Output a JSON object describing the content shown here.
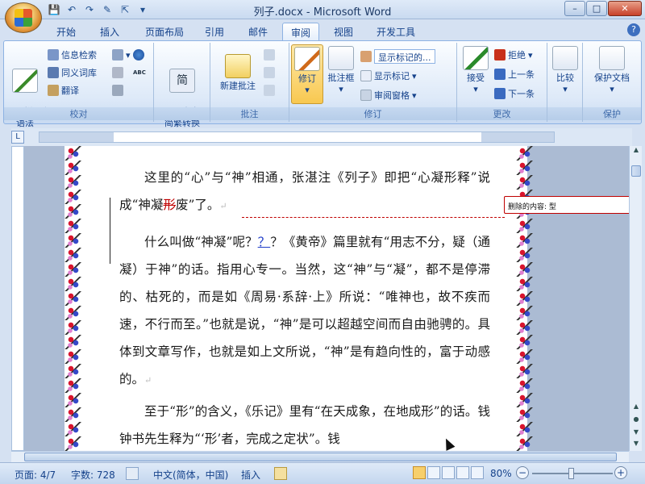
{
  "window": {
    "title": "列子.docx - Microsoft Word",
    "controls": [
      "–",
      "□",
      "✕"
    ]
  },
  "qat": [
    "💾",
    "↶",
    "↷",
    "✎",
    "⇱",
    "▾"
  ],
  "tabs": [
    {
      "label": "开始",
      "active": false
    },
    {
      "label": "插入",
      "active": false
    },
    {
      "label": "页面布局",
      "active": false
    },
    {
      "label": "引用",
      "active": false
    },
    {
      "label": "邮件",
      "active": false
    },
    {
      "label": "审阅",
      "active": true
    },
    {
      "label": "视图",
      "active": false
    },
    {
      "label": "开发工具",
      "active": false
    }
  ],
  "help": "?",
  "ribbon": {
    "proofing": {
      "label": "校对",
      "spelling": "拼写和\n语法",
      "research": "信息检索",
      "thesaurus": "同义词库",
      "translate": "翻译",
      "abc_icon": "ABC"
    },
    "chinese": {
      "label": "",
      "convert": "中文\n简繁转换",
      "icon_char": "简"
    },
    "comments": {
      "label": "批注",
      "new_comment": "新建批注"
    },
    "tracking": {
      "label": "修订",
      "track_changes": "修订",
      "balloons": "批注框",
      "display_combo": "显示标记的...",
      "show_markup": "显示标记",
      "reviewing_pane": "审阅窗格"
    },
    "changes": {
      "label": "更改",
      "accept": "接受",
      "reject": "拒绝",
      "previous": "上一条",
      "next": "下一条"
    },
    "compare": {
      "label": "",
      "compare": "比较"
    },
    "protect": {
      "label": "保护",
      "protect_doc": "保护文档"
    }
  },
  "document": {
    "p1": {
      "before": "这里的“心”与“神”相通，张湛注《列子》即把“心凝形释”说成“神凝",
      "deleted": "形",
      "after": "废”了。",
      "mark": "↵"
    },
    "p2": {
      "before": "什么叫做“神凝”呢？",
      "inserted": "？",
      "after": "？《黄帝》篇里就有“用志不分，疑（通凝）于神”的话。指用心专一。当然，这“神”与“凝”，都不是停滞的、枯死的，而是如《周易·系辞·上》所说：“唯神也，故不疾而速，不行而至。”也就是说，“神”是可以超越空间而自由驰骋的。具体到文章写作，也就是如上文所说，“神”是有趋向性的，富于动感的。",
      "mark": "↵"
    },
    "p3": {
      "text": "至于“形”的含义，《乐记》里有“在天成象，在地成形”的话。钱钟书先生释为“‘形’者，完成之定状”。钱"
    },
    "balloon": "删除的内容: 型"
  },
  "status": {
    "page": "页面: 4/7",
    "words": "字数: 728",
    "language": "中文(简体，中国)",
    "insert_mode": "插入",
    "zoom": "80%"
  }
}
